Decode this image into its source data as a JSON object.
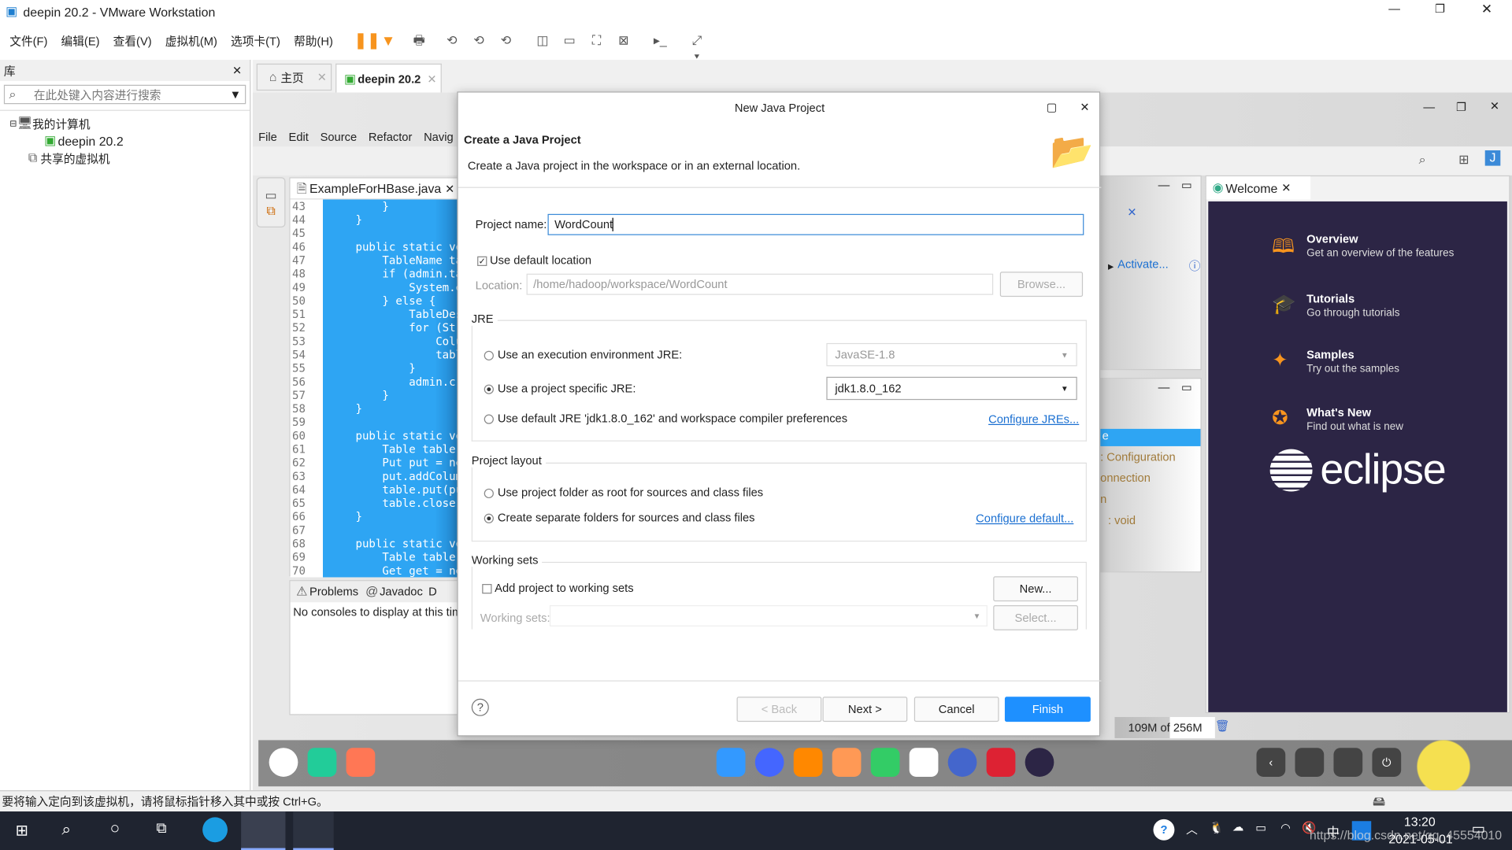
{
  "window": {
    "title": "deepin 20.2 - VMware Workstation"
  },
  "vm_menu": [
    "文件(F)",
    "编辑(E)",
    "查看(V)",
    "虚拟机(M)",
    "选项卡(T)",
    "帮助(H)"
  ],
  "library": {
    "title": "库",
    "search_placeholder": "在此处键入内容进行搜索",
    "tree": [
      "我的计算机",
      "deepin 20.2",
      "共享的虚拟机"
    ]
  },
  "vm_tabs": [
    {
      "label": "主页"
    },
    {
      "label": "deepin 20.2"
    }
  ],
  "eclipse": {
    "menu": [
      "File",
      "Edit",
      "Source",
      "Refactor",
      "Navig"
    ],
    "editor_tab": "ExampleForHBase.java",
    "code": [
      {
        "n": "43",
        "t": "        }"
      },
      {
        "n": "44",
        "t": "    }"
      },
      {
        "n": "45",
        "t": ""
      },
      {
        "n": "46",
        "t": "    public static vo"
      },
      {
        "n": "47",
        "t": "        TableName tab"
      },
      {
        "n": "48",
        "t": "        if (admin.tab"
      },
      {
        "n": "49",
        "t": "            System.ou"
      },
      {
        "n": "50",
        "t": "        } else {"
      },
      {
        "n": "51",
        "t": "            TableDesc"
      },
      {
        "n": "52",
        "t": "            for (Stri"
      },
      {
        "n": "53",
        "t": "                Column"
      },
      {
        "n": "54",
        "t": "                table"
      },
      {
        "n": "55",
        "t": "            }"
      },
      {
        "n": "56",
        "t": "            admin.crea"
      },
      {
        "n": "57",
        "t": "        }"
      },
      {
        "n": "58",
        "t": "    }"
      },
      {
        "n": "59",
        "t": ""
      },
      {
        "n": "60",
        "t": "    public static vo"
      },
      {
        "n": "61",
        "t": "        Table table ="
      },
      {
        "n": "62",
        "t": "        Put put = new"
      },
      {
        "n": "63",
        "t": "        put.addColumn"
      },
      {
        "n": "64",
        "t": "        table.put(put"
      },
      {
        "n": "65",
        "t": "        table.close()"
      },
      {
        "n": "66",
        "t": "    }"
      },
      {
        "n": "67",
        "t": ""
      },
      {
        "n": "68",
        "t": "    public static vo"
      },
      {
        "n": "69",
        "t": "        Table table ="
      },
      {
        "n": "70",
        "t": "        Get get = new"
      }
    ],
    "bottom_tabs": [
      "Problems",
      "Javadoc",
      "D"
    ],
    "console": "No consoles to display at this time",
    "activate": "Activate...",
    "outline_items": [
      "e",
      ": Configuration",
      "onnection",
      "n",
      ": void"
    ],
    "welcome_tab": "Welcome",
    "welcome_items": [
      {
        "title": "Overview",
        "desc": "Get an overview of the features",
        "icon": "book-icon"
      },
      {
        "title": "Tutorials",
        "desc": "Go through tutorials",
        "icon": "mortarboard-icon"
      },
      {
        "title": "Samples",
        "desc": "Try out the samples",
        "icon": "magic-wand-icon"
      },
      {
        "title": "What's New",
        "desc": "Find out what is new",
        "icon": "star-icon"
      }
    ],
    "logo": "eclipse",
    "heap": "109M of 256M"
  },
  "dialog": {
    "title": "New Java Project",
    "header": "Create a Java Project",
    "subtitle": "Create a Java project in the workspace or in an external location.",
    "project_name_label": "Project name:",
    "project_name": "WordCount",
    "use_default_location": "Use default location",
    "location_label": "Location:",
    "location": "/home/hadoop/workspace/WordCount",
    "browse": "Browse...",
    "jre_group": "JRE",
    "jre_opt1": "Use an execution environment JRE:",
    "jre_opt1_value": "JavaSE-1.8",
    "jre_opt2": "Use a project specific JRE:",
    "jre_opt2_value": "jdk1.8.0_162",
    "jre_opt3": "Use default JRE 'jdk1.8.0_162' and workspace compiler preferences",
    "configure_jres": "Configure JREs...",
    "layout_group": "Project layout",
    "layout_opt1": "Use project folder as root for sources and class files",
    "layout_opt2": "Create separate folders for sources and class files",
    "configure_default": "Configure default...",
    "ws_group": "Working sets",
    "ws_add": "Add project to working sets",
    "ws_new": "New...",
    "ws_label": "Working sets:",
    "ws_select": "Select...",
    "back": "< Back",
    "next": "Next >",
    "cancel": "Cancel",
    "finish": "Finish"
  },
  "vm_status": "要将输入定向到该虚拟机，请将鼠标指针移入其中或按 Ctrl+G。",
  "taskbar": {
    "time": "13:20",
    "date": "2021-05-01",
    "ime": "中",
    "watermark": "https://blog.csdn.net/qq_45554010"
  },
  "colors": {
    "selection": "#2ea5f3",
    "welcome_bg": "#2c2545",
    "accent": "#1e90ff",
    "welcome_icon": "#f7941e"
  }
}
